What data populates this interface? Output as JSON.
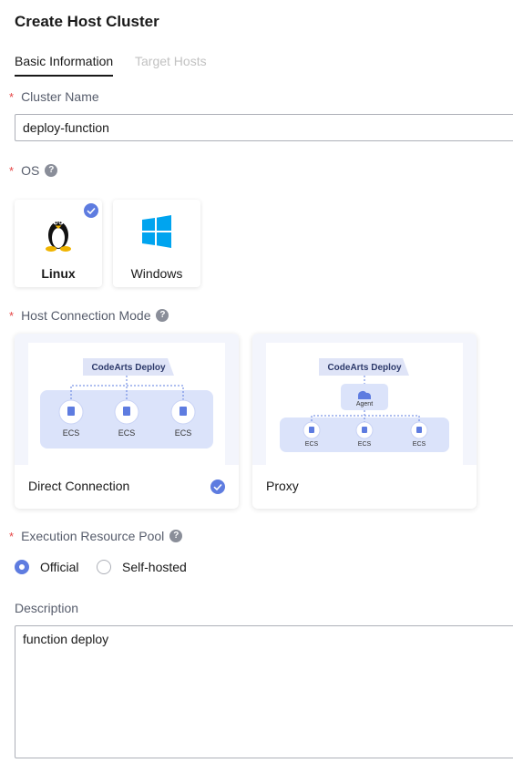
{
  "page": {
    "title": "Create Host Cluster"
  },
  "tabs": [
    {
      "label": "Basic Information",
      "active": true
    },
    {
      "label": "Target Hosts",
      "active": false
    }
  ],
  "required_mark": "*",
  "cluster_name": {
    "label": "Cluster Name",
    "value": "deploy-function"
  },
  "os": {
    "label": "OS",
    "help_icon": "question-circle-icon",
    "options": [
      {
        "label": "Linux",
        "icon": "linux-penguin-icon",
        "selected": true
      },
      {
        "label": "Windows",
        "icon": "windows-logo-icon",
        "selected": false
      }
    ]
  },
  "connection_mode": {
    "label": "Host Connection Mode",
    "help_icon": "question-circle-icon",
    "options": [
      {
        "label": "Direct Connection",
        "selected": true,
        "diagram": {
          "top": "CodeArts Deploy",
          "nodes": [
            "ECS",
            "ECS",
            "ECS"
          ]
        }
      },
      {
        "label": "Proxy",
        "selected": false,
        "diagram": {
          "top": "CodeArts Deploy",
          "middle": "Agent",
          "nodes": [
            "ECS",
            "ECS",
            "ECS"
          ]
        }
      }
    ]
  },
  "resource_pool": {
    "label": "Execution Resource Pool",
    "help_icon": "question-circle-icon",
    "options": [
      {
        "label": "Official",
        "selected": true
      },
      {
        "label": "Self-hosted",
        "selected": false
      }
    ]
  },
  "description": {
    "label": "Description",
    "value": "function deploy"
  },
  "colors": {
    "accent": "#5e7ce0",
    "required": "#e54545",
    "border": "#adb0b8"
  }
}
